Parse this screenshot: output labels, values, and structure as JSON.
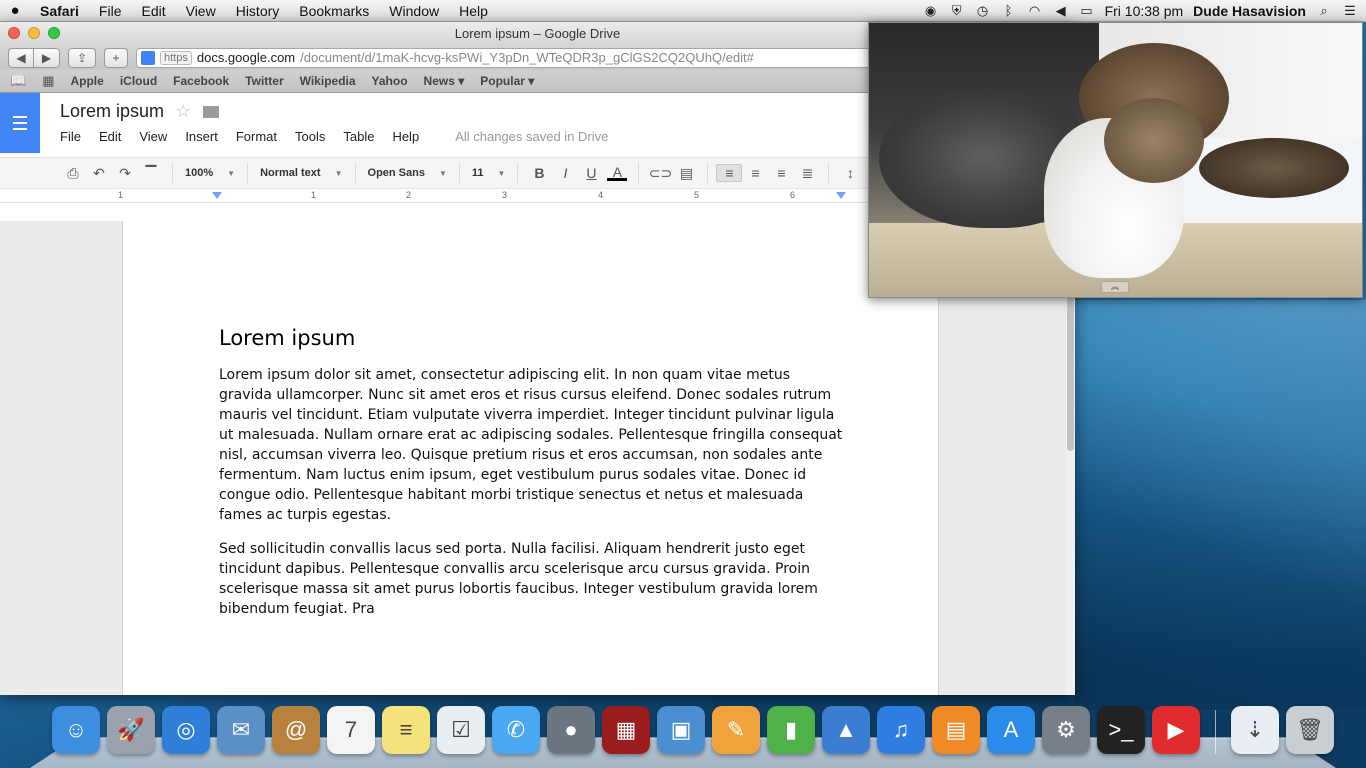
{
  "menubar": {
    "app_name": "Safari",
    "items": [
      "File",
      "Edit",
      "View",
      "History",
      "Bookmarks",
      "Window",
      "Help"
    ],
    "clock": "Fri 10:38 pm",
    "user": "Dude Hasavision"
  },
  "window": {
    "title": "Lorem ipsum – Google Drive",
    "url_scheme": "https",
    "url_host": "docs.google.com",
    "url_path": "/document/d/1maK-hcvg-ksPWi_Y3pDn_WTeQDR3p_gClGS2CQ2QUhQ/edit#"
  },
  "bookmarks": [
    "Apple",
    "iCloud",
    "Facebook",
    "Twitter",
    "Wikipedia",
    "Yahoo",
    "News ▾",
    "Popular ▾"
  ],
  "docs": {
    "title": "Lorem ipsum",
    "menu": [
      "File",
      "Edit",
      "View",
      "Insert",
      "Format",
      "Tools",
      "Table",
      "Help"
    ],
    "save_status": "All changes saved in Drive",
    "toolbar": {
      "zoom": "100%",
      "style": "Normal text",
      "font": "Open Sans",
      "size": "11"
    },
    "ruler_numbers": [
      "1",
      "1",
      "2",
      "3",
      "4",
      "5",
      "6"
    ]
  },
  "document": {
    "heading": "Lorem ipsum",
    "paragraph1": "Lorem ipsum dolor sit amet, consectetur adipiscing elit. In non quam vitae metus gravida ullamcorper. Nunc sit amet eros et risus cursus eleifend. Donec sodales rutrum mauris vel tincidunt. Etiam vulputate viverra imperdiet. Integer tincidunt pulvinar ligula ut malesuada. Nullam ornare erat ac adipiscing sodales. Pellentesque fringilla consequat nisl, accumsan viverra leo. Quisque pretium risus et eros accumsan, non sodales ante fermentum. Nam luctus enim ipsum, eget vestibulum purus sodales vitae. Donec id congue odio. Pellentesque habitant morbi tristique senectus et netus et malesuada fames ac turpis egestas.",
    "paragraph2": "Sed sollicitudin convallis lacus sed porta. Nulla facilisi. Aliquam hendrerit justo eget tincidunt dapibus. Pellentesque convallis arcu scelerisque arcu cursus gravida. Proin scelerisque massa sit amet purus lobortis faucibus. Integer vestibulum gravida lorem bibendum feugiat. Pra"
  },
  "dock": [
    {
      "name": "finder",
      "color": "#3d8ee0",
      "glyph": "☺"
    },
    {
      "name": "launchpad",
      "color": "#9aa3ad",
      "glyph": "🚀"
    },
    {
      "name": "safari",
      "color": "#2f7ed8",
      "glyph": "◎"
    },
    {
      "name": "mail",
      "color": "#5a8fc7",
      "glyph": "✉"
    },
    {
      "name": "contacts",
      "color": "#b8823e",
      "glyph": "@"
    },
    {
      "name": "calendar",
      "color": "#f4f4f4",
      "glyph": "7"
    },
    {
      "name": "notes",
      "color": "#f3e37a",
      "glyph": "≡"
    },
    {
      "name": "reminders",
      "color": "#e9eef3",
      "glyph": "☑"
    },
    {
      "name": "messages",
      "color": "#4aa7f2",
      "glyph": "✆"
    },
    {
      "name": "facetime",
      "color": "#6c7680",
      "glyph": "●"
    },
    {
      "name": "photo-booth",
      "color": "#9b1c1c",
      "glyph": "▦"
    },
    {
      "name": "iphoto",
      "color": "#4c8fd0",
      "glyph": "▣"
    },
    {
      "name": "pages",
      "color": "#f0a33c",
      "glyph": "✎"
    },
    {
      "name": "numbers",
      "color": "#4fb14a",
      "glyph": "▮"
    },
    {
      "name": "keynote",
      "color": "#3b7dd0",
      "glyph": "▲"
    },
    {
      "name": "itunes",
      "color": "#2d7ee0",
      "glyph": "♫"
    },
    {
      "name": "ibooks",
      "color": "#f08a24",
      "glyph": "▤"
    },
    {
      "name": "app-store",
      "color": "#2a8ce8",
      "glyph": "A"
    },
    {
      "name": "system-preferences",
      "color": "#777f88",
      "glyph": "⚙"
    },
    {
      "name": "terminal",
      "color": "#222222",
      "glyph": ">_"
    },
    {
      "name": "youtube",
      "color": "#e02c2c",
      "glyph": "▶"
    }
  ],
  "dock_right": [
    {
      "name": "downloads",
      "color": "#e8eef3",
      "glyph": "⇣"
    },
    {
      "name": "trash",
      "color": "#c9ced3",
      "glyph": "🗑"
    }
  ]
}
